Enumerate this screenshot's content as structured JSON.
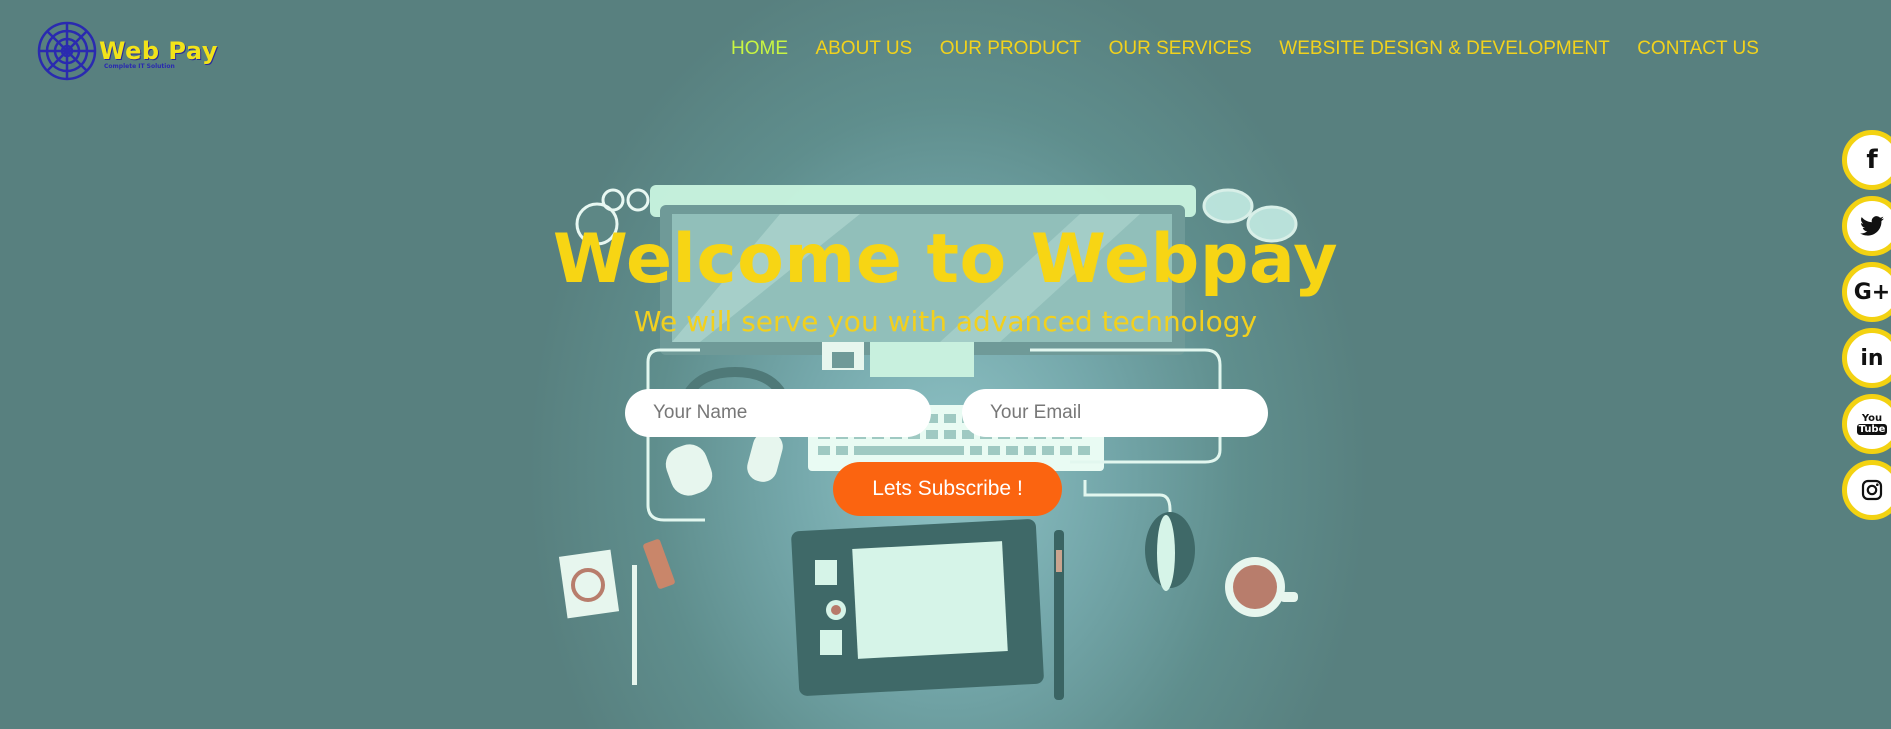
{
  "brand": {
    "name": "Web Pay",
    "tagline": "Complete IT Solution"
  },
  "nav": {
    "items": [
      {
        "label": "HOME",
        "active": true
      },
      {
        "label": "ABOUT US"
      },
      {
        "label": "OUR PRODUCT"
      },
      {
        "label": "OUR SERVICES"
      },
      {
        "label": "WEBSITE DESIGN & DEVELOPMENT"
      },
      {
        "label": "CONTACT US"
      }
    ]
  },
  "hero": {
    "title": "Welcome to Webpay",
    "subtitle": "We will serve you with advanced technology"
  },
  "form": {
    "name_placeholder": "Your Name",
    "email_placeholder": "Your Email",
    "subscribe_label": "Lets Subscribe !"
  },
  "social": {
    "icons": [
      "facebook-icon",
      "twitter-icon",
      "google-plus-icon",
      "linkedin-icon",
      "youtube-icon",
      "instagram-icon"
    ],
    "glyphs": {
      "facebook": "f",
      "google_plus": "G+",
      "linkedin": "in",
      "youtube_top": "You",
      "youtube_bottom": "Tube"
    }
  },
  "colors": {
    "background": "#5a8584",
    "accent_yellow": "#f7d514",
    "nav_active": "#c8f542",
    "subscribe_button": "#fb6410",
    "logo_blue": "#2a2ab0"
  }
}
